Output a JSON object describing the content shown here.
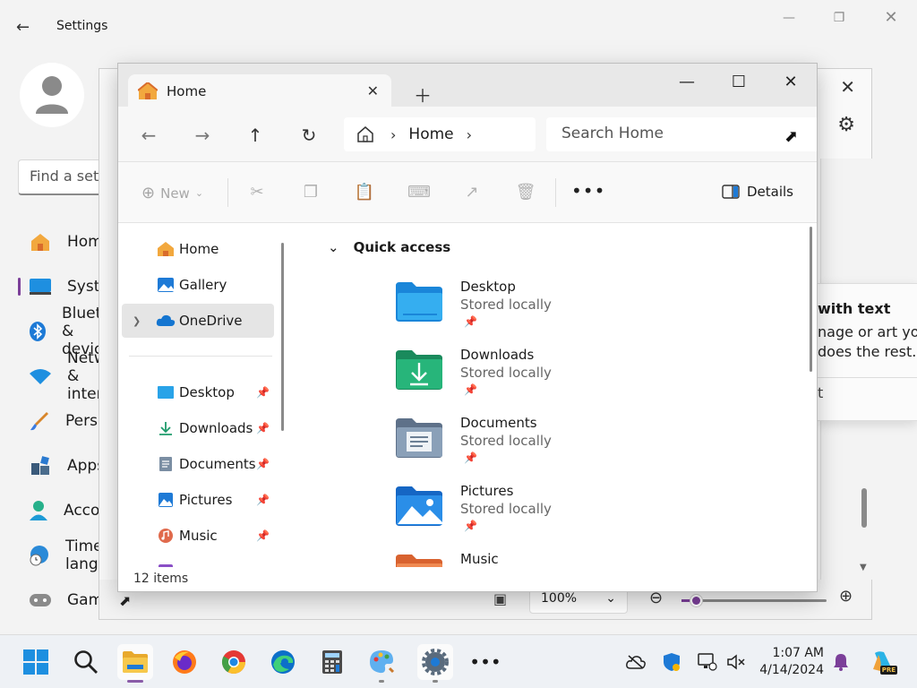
{
  "settings": {
    "title": "Settings",
    "find_placeholder": "Find a setting",
    "nav": [
      {
        "label": "Home"
      },
      {
        "label": "System"
      },
      {
        "label": "Bluetooth & devices"
      },
      {
        "label": "Network & internet"
      },
      {
        "label": "Personalization"
      },
      {
        "label": "Apps"
      },
      {
        "label": "Accounts"
      },
      {
        "label": "Time & language"
      },
      {
        "label": "Gaming"
      }
    ]
  },
  "paint": {
    "zoom_value": "100%",
    "zoom_level": 0.1,
    "popup_heading": "with text",
    "popup_line1": "nage or art you",
    "popup_line2": "does the rest.",
    "popup_tail": "t"
  },
  "explorer": {
    "tab_label": "Home",
    "breadcrumb": [
      "Home"
    ],
    "search_placeholder": "Search Home",
    "toolbar": {
      "new_label": "New",
      "details_label": "Details"
    },
    "sidebar": {
      "top": [
        {
          "label": "Home"
        },
        {
          "label": "Gallery"
        },
        {
          "label": "OneDrive"
        }
      ],
      "pinned": [
        {
          "label": "Desktop"
        },
        {
          "label": "Downloads"
        },
        {
          "label": "Documents"
        },
        {
          "label": "Pictures"
        },
        {
          "label": "Music"
        }
      ]
    },
    "quick_access": {
      "title": "Quick access",
      "items": [
        {
          "name": "Desktop",
          "status": "Stored locally"
        },
        {
          "name": "Downloads",
          "status": "Stored locally"
        },
        {
          "name": "Documents",
          "status": "Stored locally"
        },
        {
          "name": "Pictures",
          "status": "Stored locally"
        },
        {
          "name": "Music",
          "status": ""
        }
      ]
    },
    "status": "12 items"
  },
  "taskbar": {
    "time": "1:07 AM",
    "date": "4/14/2024",
    "copilot_badge": "PRE"
  },
  "colors": {
    "accent": "#7b3f99",
    "folder_blue": "#1e8fe0",
    "folder_green": "#21a06e"
  }
}
